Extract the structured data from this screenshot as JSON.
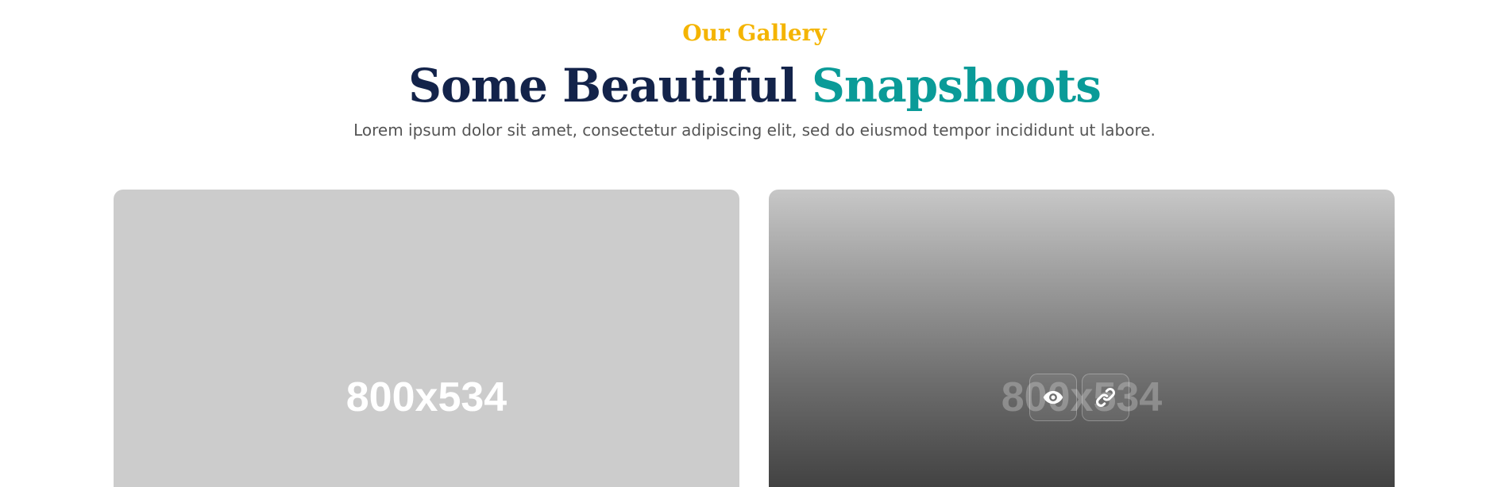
{
  "header": {
    "eyebrow": "Our Gallery",
    "title_main": "Some Beautiful ",
    "title_accent": "Snapshoots",
    "subtitle": "Lorem ipsum dolor sit amet, consectetur adipiscing elit, sed do eiusmod tempor incididunt ut labore."
  },
  "gallery": {
    "items": [
      {
        "placeholder": "800x534"
      },
      {
        "placeholder": "800x534",
        "actions": [
          {
            "icon": "eye-icon"
          },
          {
            "icon": "link-icon"
          }
        ]
      }
    ]
  },
  "colors": {
    "eyebrow": "#f4b400",
    "title": "#13234a",
    "accent": "#0a9b98",
    "body_text": "#555555",
    "placeholder_bg": "#cccccc"
  }
}
